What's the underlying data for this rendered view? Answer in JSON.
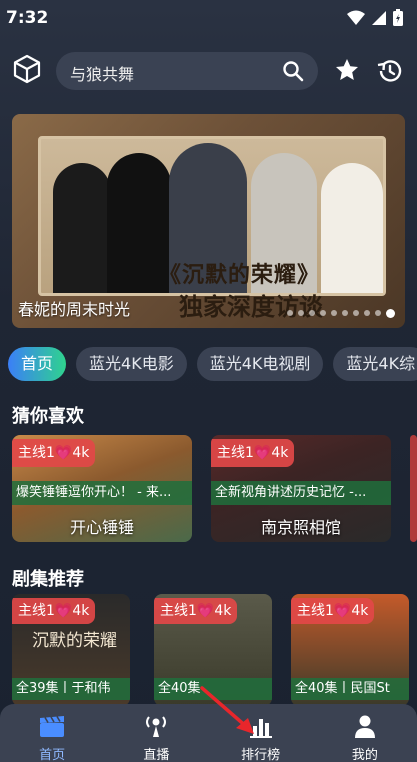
{
  "status": {
    "time": "7:32"
  },
  "search": {
    "query": "与狼共舞"
  },
  "banner": {
    "caption": "春妮的周末时光",
    "headline_line1": "《沉默的荣耀》",
    "headline_line2": "独家深度访谈",
    "dots_count": 10,
    "active_dot_index": 9
  },
  "tabs": [
    "首页",
    "蓝光4K电影",
    "蓝光4K电视剧",
    "蓝光4K综"
  ],
  "recommend": {
    "title": "猜你喜欢",
    "items": [
      {
        "badge": "主线1💗4k",
        "desc": "爆笑锤锤逗你开心！ - 来...",
        "title": "开心锤锤"
      },
      {
        "badge": "主线1💗4k",
        "desc": "全新视角讲述历史记忆 -...",
        "title": "南京照相馆"
      }
    ]
  },
  "series": {
    "title": "剧集推荐",
    "items": [
      {
        "badge": "主线1💗4k",
        "poster_text": "沉默的荣耀",
        "sub": "全39集丨于和伟"
      },
      {
        "badge": "主线1💗4k",
        "poster_text": "",
        "sub": "全40集"
      },
      {
        "badge": "主线1💗4k",
        "poster_text": "",
        "sub": "全40集丨民国St"
      }
    ]
  },
  "nav": [
    {
      "label": "首页",
      "icon": "clapperboard-icon",
      "active": true
    },
    {
      "label": "直播",
      "icon": "podcast-icon",
      "active": false
    },
    {
      "label": "排行榜",
      "icon": "bar-chart-icon",
      "active": false
    },
    {
      "label": "我的",
      "icon": "user-icon",
      "active": false
    }
  ],
  "colors": {
    "accent_blue": "#3b7ff7",
    "accent_green": "#2fd38e",
    "badge_red": "#e24848",
    "arrow_red": "#e8262b"
  }
}
